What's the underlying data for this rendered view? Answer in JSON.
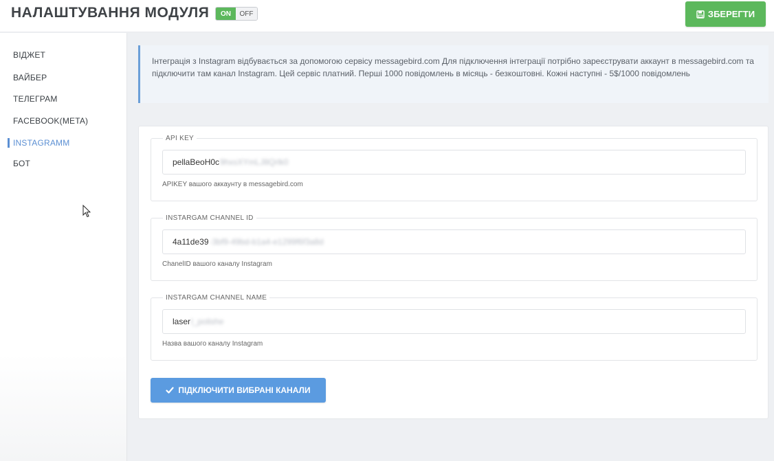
{
  "header": {
    "title": "НАЛАШТУВАННЯ МОДУЛЯ",
    "toggle_on": "ON",
    "toggle_off": "OFF",
    "save_label": "ЗБЕРЕГТИ",
    "save_icon": "save-icon"
  },
  "sidebar": {
    "items": [
      {
        "label": "ВІДЖЕТ"
      },
      {
        "label": "ВАЙБЕР"
      },
      {
        "label": "ТЕЛЕГРАМ"
      },
      {
        "label": "FACEBOOK(META)"
      },
      {
        "label": "INSTAGRAMM"
      },
      {
        "label": "БОТ"
      }
    ],
    "active": "INSTAGRAMM"
  },
  "info": {
    "text": "Інтеграція з Instagram відбувається за допомогою сервісу messagebird.com Для підключення інтеграції потрібно зареєструвати аккаунт в messagebird.com та підключити там канал Instagram. Цей сервіс платний. Перші 1000 повідомлень в місяць - безкоштовні. Кожні наступні - 5$/1000 повідомлень"
  },
  "fields": [
    {
      "legend": "API KEY",
      "value_visible": "pellaBeoH0c",
      "value_masked": "9hxsXYmLJ8Qrlk0",
      "hint": "APIKEY вашого аккаунту в messagebird.com"
    },
    {
      "legend": "INSTARGAM CHANNEL ID",
      "value_visible": "4a11de39",
      "value_masked": "-3bf9-49bd-b1a4-e1299f6f3a8d",
      "hint": "ChanelID вашого каналу Instagram"
    },
    {
      "legend": "INSTARGAM CHANNEL NAME",
      "value_visible": "laser",
      "value_masked": "l_polishe",
      "hint": "Назва вашого каналу Instagram"
    }
  ],
  "connect_button": {
    "label": "ПІДКЛЮЧИТИ ВИБРАНІ КАНАЛИ",
    "icon": "check-icon"
  },
  "colors": {
    "green": "#5cb85c",
    "blue_button": "#5b9be0",
    "active_nav": "#5b8fd3",
    "info_border": "#6b9fd8"
  }
}
